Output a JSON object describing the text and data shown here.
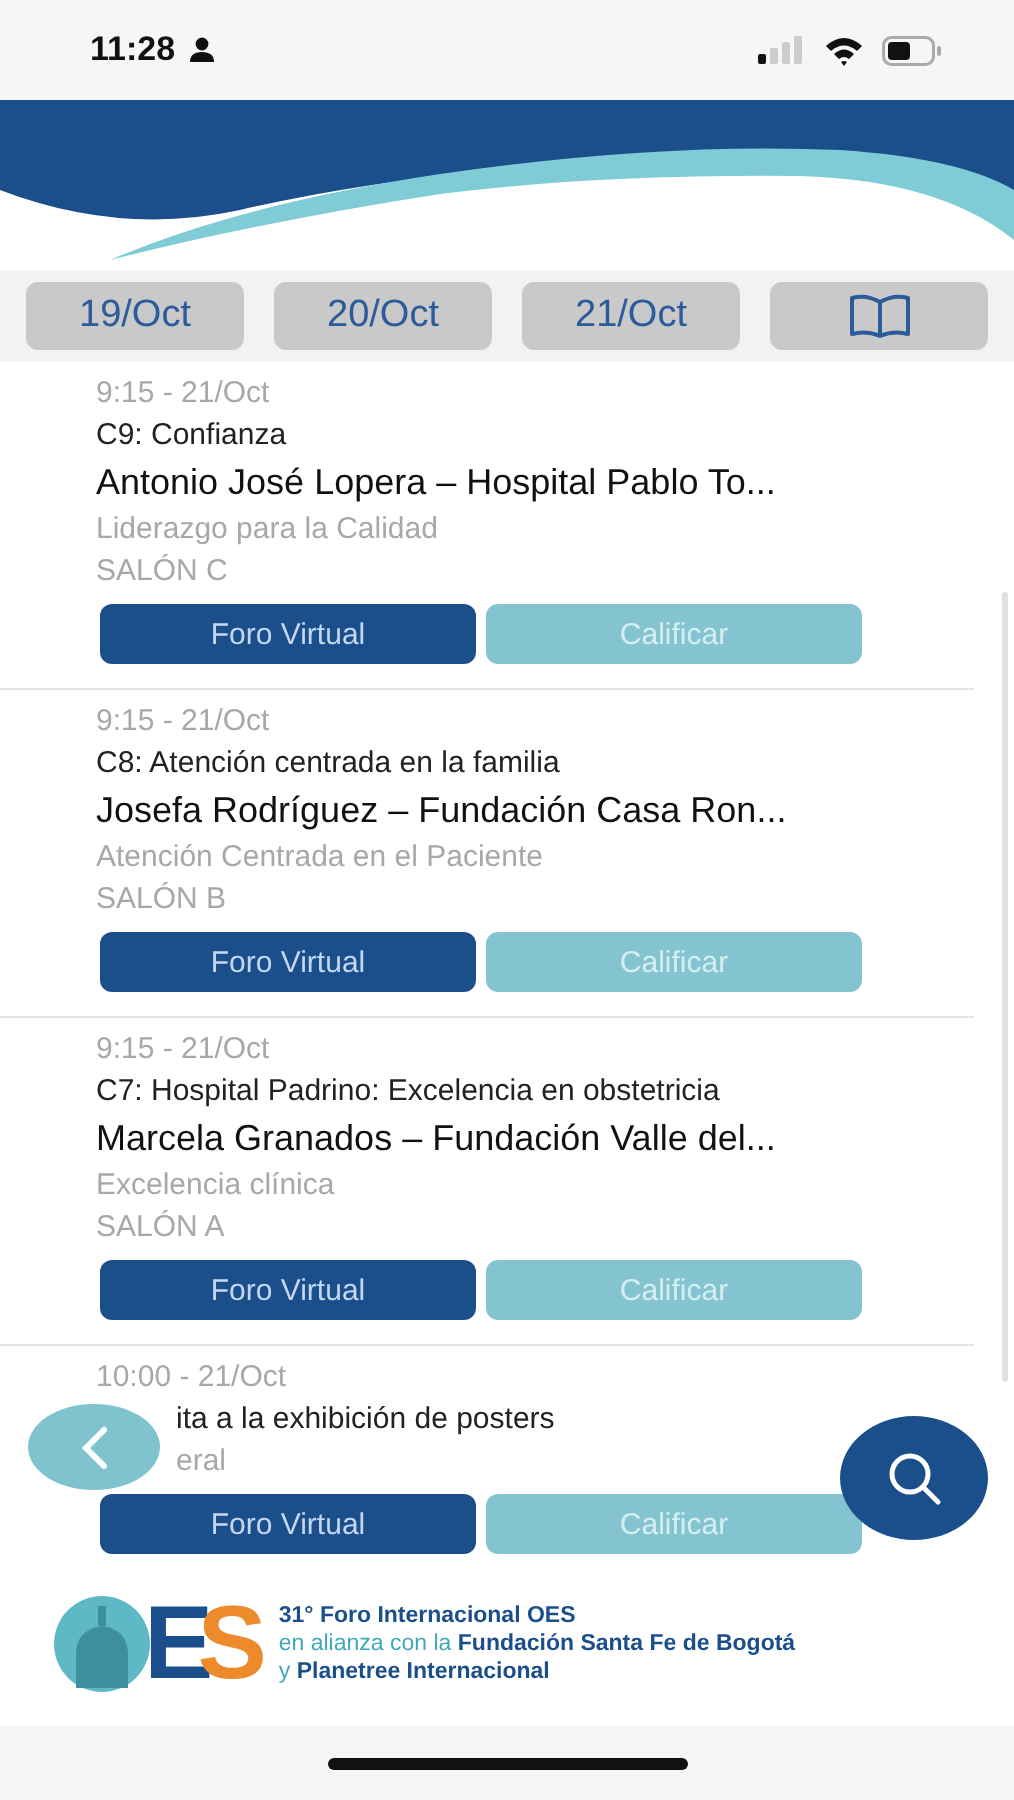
{
  "status_bar": {
    "time": "11:28"
  },
  "tabs": [
    {
      "label": "19/Oct",
      "kind": "text"
    },
    {
      "label": "20/Oct",
      "kind": "text"
    },
    {
      "label": "21/Oct",
      "kind": "text"
    },
    {
      "kind": "book"
    }
  ],
  "sessions": [
    {
      "kind": "full",
      "time": "9:15 - 21/Oct",
      "code": "C9: Confianza",
      "speaker": "Antonio José Lopera – Hospital Pablo To...",
      "category": "Liderazgo para la Calidad",
      "room": "SALÓN C",
      "buttons": [
        {
          "label": "Foro Virtual",
          "disabled": false
        },
        {
          "label": "Calificar",
          "disabled": true
        }
      ]
    },
    {
      "kind": "full",
      "time": "9:15 - 21/Oct",
      "code": "C8: Atención centrada en la familia",
      "speaker": "Josefa Rodríguez – Fundación Casa Ron...",
      "category": "Atención Centrada en el Paciente",
      "room": "SALÓN B",
      "buttons": [
        {
          "label": "Foro Virtual",
          "disabled": false
        },
        {
          "label": "Calificar",
          "disabled": true
        }
      ]
    },
    {
      "kind": "full",
      "time": "9:15 - 21/Oct",
      "code": "C7: Hospital Padrino: Excelencia en obstetricia",
      "speaker": "Marcela Granados – Fundación Valle del...",
      "category": "Excelencia clínica",
      "room": "SALÓN A",
      "buttons": [
        {
          "label": "Foro Virtual",
          "disabled": false
        },
        {
          "label": "Calificar",
          "disabled": true
        }
      ]
    },
    {
      "kind": "partial",
      "time": "10:00 - 21/Oct",
      "code": "ita a la exhibición de posters",
      "category": "eral",
      "buttons": [
        {
          "label": "Foro Virtual",
          "disabled": false
        },
        {
          "label": "Calificar",
          "disabled": true
        }
      ]
    }
  ],
  "footer": {
    "logo_letters": [
      "E",
      "S"
    ],
    "lines": [
      "**31° Foro Internacional OES**",
      "en alianza con la **Fundación Santa Fe de Bogotá**",
      "y **Planetree Internacional**"
    ]
  }
}
